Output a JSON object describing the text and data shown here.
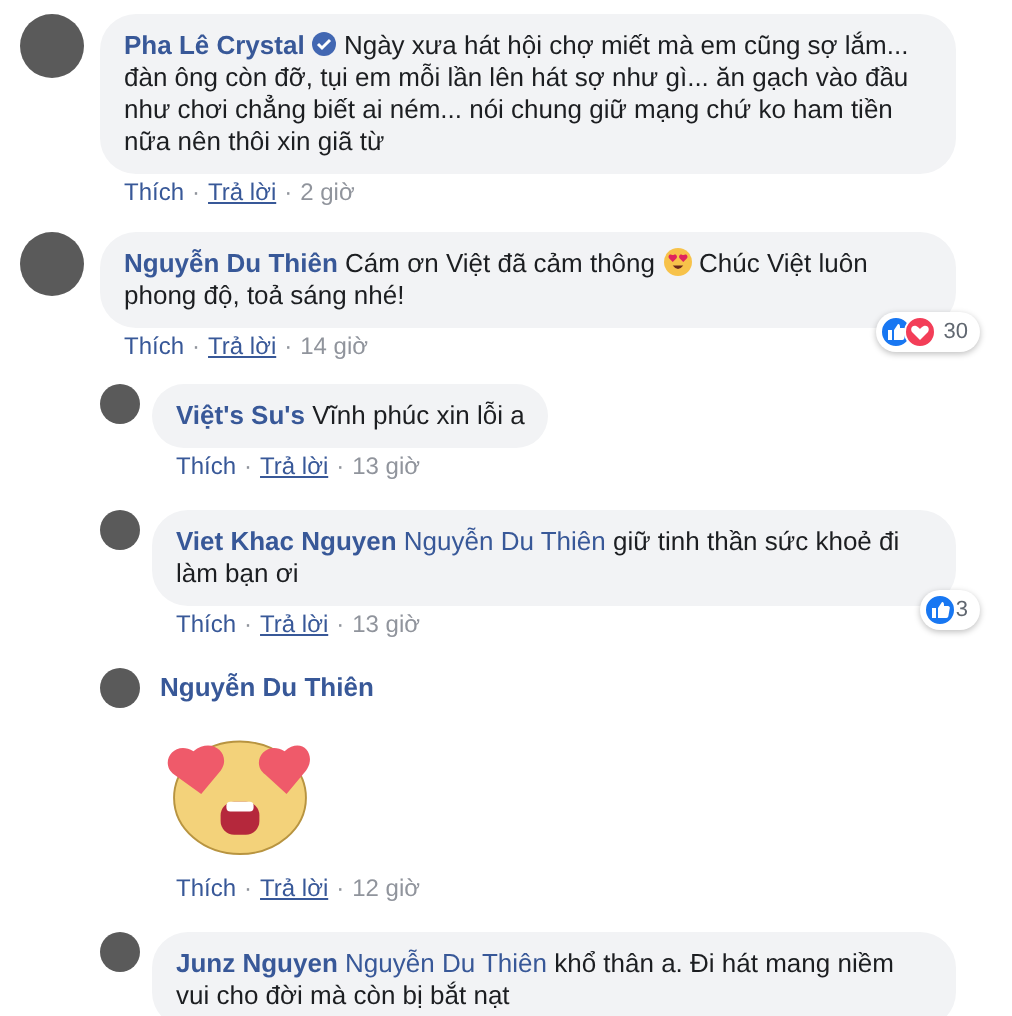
{
  "comments": [
    {
      "kind": "text",
      "name": "Pha Lê Crystal",
      "verified": true,
      "text_parts": [
        "Ngày xưa hát hội chợ miết mà em cũng sợ lắm... đàn ông còn đỡ, tụi em mỗi lần lên hát sợ như gì... ăn gạch vào đầu như chơi chẳng biết ai ném... nói chung giữ mạng chứ ko ham tiền nữa nên thôi xin giã từ"
      ],
      "like": "Thích",
      "separators": [
        "·",
        "·"
      ],
      "reply": "Trả lời",
      "time": "2 giờ"
    },
    {
      "kind": "text",
      "name": "Nguyễn Du Thiên",
      "verified": false,
      "text_parts": [
        "Cám ơn Việt đã cảm thông",
        "Chúc Việt luôn phong độ, toả sáng nhé!"
      ],
      "reactions": [
        {
          "kind": "like"
        },
        {
          "kind": "love"
        }
      ],
      "reaction_count": "30",
      "like": "Thích",
      "separators": [
        "·",
        "·"
      ],
      "reply": "Trả lời",
      "time": "14 giờ",
      "children": [
        {
          "kind": "text",
          "name": "Việt's Su's",
          "verified": false,
          "text_parts": [
            "Vĩnh phúc xin lỗi a"
          ],
          "like": "Thích",
          "separators": [
            "·",
            "·"
          ],
          "reply": "Trả lời",
          "time": "13 giờ"
        },
        {
          "kind": "text",
          "name": "Viet Khac Nguyen",
          "verified": false,
          "mention": "Nguyễn Du Thiên",
          "text_parts": [
            "giữ tinh thần sức khoẻ đi làm bạn ơi"
          ],
          "reactions": [
            {
              "kind": "like"
            }
          ],
          "reaction_count": "3",
          "like": "Thích",
          "separators": [
            "·",
            "·"
          ],
          "reply": "Trả lời",
          "time": "13 giờ"
        },
        {
          "kind": "sticker",
          "name": "Nguyễn Du Thiên",
          "verified": false,
          "like": "Thích",
          "separators": [
            "·",
            "·"
          ],
          "reply": "Trả lời",
          "time": "12 giờ"
        },
        {
          "kind": "text",
          "name": "Junz Nguyen",
          "verified": false,
          "mention": "Nguyễn Du Thiên",
          "text_parts": [
            "khổ thân a. Đi hát mang niềm vui cho đời mà còn bị bắt nạt"
          ]
        }
      ]
    }
  ]
}
